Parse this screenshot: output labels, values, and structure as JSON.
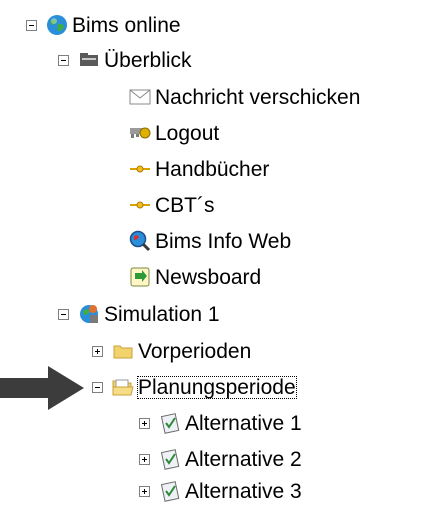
{
  "tree": {
    "root": {
      "label": "Bims online",
      "icon": "globe-icon"
    },
    "overview": {
      "label": "Überblick",
      "icon": "folder-dark-icon",
      "items": [
        {
          "label": "Nachricht verschicken",
          "icon": "envelope-icon"
        },
        {
          "label": "Logout",
          "icon": "key-icon"
        },
        {
          "label": "Handbücher",
          "icon": "link-dot-icon"
        },
        {
          "label": "CBT´s",
          "icon": "link-dot-icon"
        },
        {
          "label": "Bims Info Web",
          "icon": "magnifier-globe-icon"
        },
        {
          "label": "Newsboard",
          "icon": "newsboard-icon"
        }
      ]
    },
    "simulation": {
      "label": "Simulation 1",
      "icon": "simulation-globe-icon",
      "previous": {
        "label": "Vorperioden",
        "icon": "folder-icon"
      },
      "planning": {
        "label": "Planungsperiode",
        "icon": "open-folder-icon",
        "alternatives": [
          {
            "label": "Alternative 1",
            "icon": "checklist-icon"
          },
          {
            "label": "Alternative 2",
            "icon": "checklist-icon"
          },
          {
            "label": "Alternative 3",
            "icon": "checklist-icon"
          }
        ]
      }
    }
  },
  "pointer": {
    "icon": "right-arrow-icon",
    "color": "#3c3c3c"
  },
  "colors": {
    "expander_border": "#7f7f7f",
    "folder": "#f2d36b",
    "globe": "#2a8fd8"
  }
}
